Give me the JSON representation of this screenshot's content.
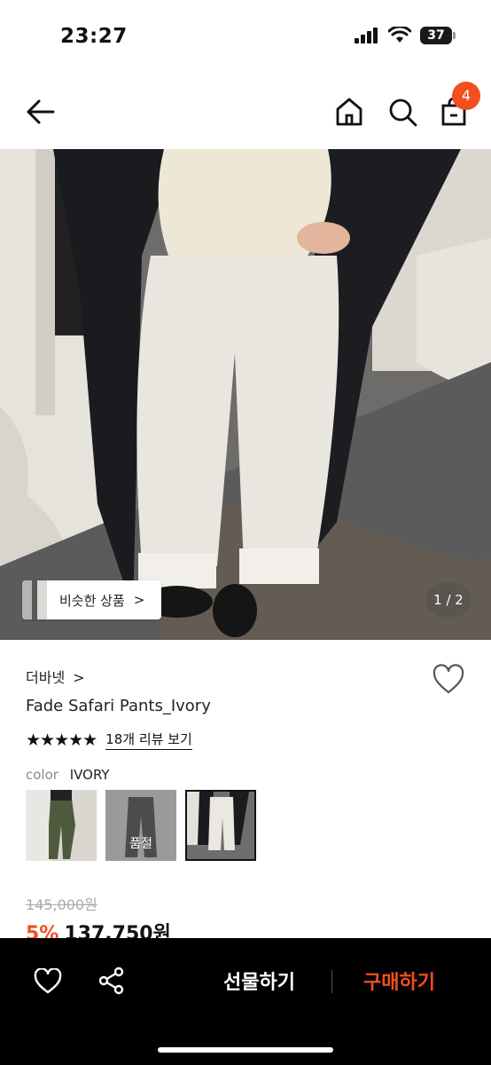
{
  "status_bar": {
    "time": "23:27",
    "battery": "37"
  },
  "nav": {
    "cart_count": "4",
    "icons": [
      "back-arrow-icon",
      "home-icon",
      "search-icon",
      "shopping-bag-icon"
    ]
  },
  "gallery": {
    "similar_label": "비슷한 상품",
    "similar_chevron": ">",
    "pager": "1 / 2"
  },
  "product": {
    "brand": "더바넷",
    "brand_chevron": ">",
    "name": "Fade Safari Pants_Ivory",
    "stars": "★★★★★",
    "rating": 4.5,
    "review_link": "18개 리뷰 보기",
    "color_label": "color",
    "color_value": "IVORY",
    "swatches": [
      {
        "name": "khaki",
        "selected": false,
        "soldout": false
      },
      {
        "name": "charcoal",
        "selected": false,
        "soldout": true,
        "soldout_label": "품절"
      },
      {
        "name": "ivory",
        "selected": true,
        "soldout": false
      }
    ],
    "original_price": "145,000원",
    "discount": "5%",
    "final_price": "137,750원"
  },
  "bottom_bar": {
    "gift_label": "선물하기",
    "buy_label": "구매하기"
  },
  "colors": {
    "accent": "#f24e1e",
    "bar": "#000000"
  }
}
